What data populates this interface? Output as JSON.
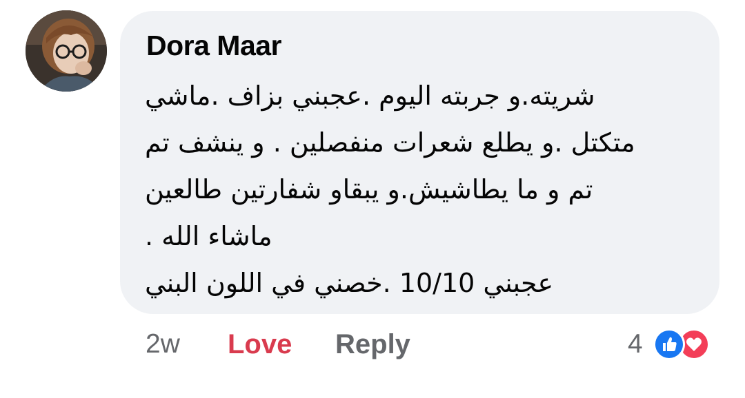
{
  "comment": {
    "author": "Dora Maar",
    "body_lines": [
      "شريته.و جربته اليوم .عجبني بزاف .ماشي",
      "متكتل .و يطلع شعرات منفصلين . و ينشف تم",
      "تم و ما يطاشيش.و يبقاو شفارتين طالعين",
      "ماشاء الله .",
      "عجبني 10/10 .خصني في اللون البني"
    ]
  },
  "actions": {
    "time": "2w",
    "love_label": "Love",
    "reply_label": "Reply"
  },
  "reactions": {
    "count": "4",
    "icons": [
      "like-icon",
      "heart-icon"
    ]
  },
  "colors": {
    "bubble": "#f0f2f5",
    "love": "#d93b4e",
    "secondary_text": "#65676b",
    "like": "#1877f2",
    "heart": "#f33e58"
  }
}
